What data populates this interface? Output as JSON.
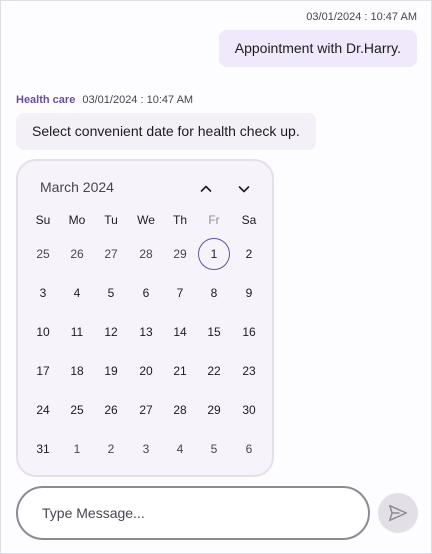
{
  "outgoing": {
    "timestamp": "03/01/2024 : 10:47 AM",
    "text": "Appointment with Dr.Harry."
  },
  "incoming": {
    "author": "Health care",
    "timestamp": "03/01/2024 : 10:47 AM",
    "text": "Select convenient date for health check up."
  },
  "calendar": {
    "title": "March 2024",
    "weekdays": [
      "Su",
      "Mo",
      "Tu",
      "We",
      "Th",
      "Fr",
      "Sa"
    ],
    "weeks": [
      [
        "25",
        "26",
        "27",
        "28",
        "29",
        "1",
        "2"
      ],
      [
        "3",
        "4",
        "5",
        "6",
        "7",
        "8",
        "9"
      ],
      [
        "10",
        "11",
        "12",
        "13",
        "14",
        "15",
        "16"
      ],
      [
        "17",
        "18",
        "19",
        "20",
        "21",
        "22",
        "23"
      ],
      [
        "24",
        "25",
        "26",
        "27",
        "28",
        "29",
        "30"
      ],
      [
        "31",
        "1",
        "2",
        "3",
        "4",
        "5",
        "6"
      ]
    ],
    "selected_day": "1",
    "icons": {
      "prev": "chevron-up-icon",
      "next": "chevron-down-icon"
    }
  },
  "composer": {
    "placeholder": "Type Message...",
    "value": "",
    "send_icon": "send-icon"
  },
  "colors": {
    "accent": "#6750a4",
    "outgoing_bubble": "#efe9fb",
    "incoming_bubble": "#f3f0f7",
    "calendar_bg": "#f7f3fb"
  }
}
